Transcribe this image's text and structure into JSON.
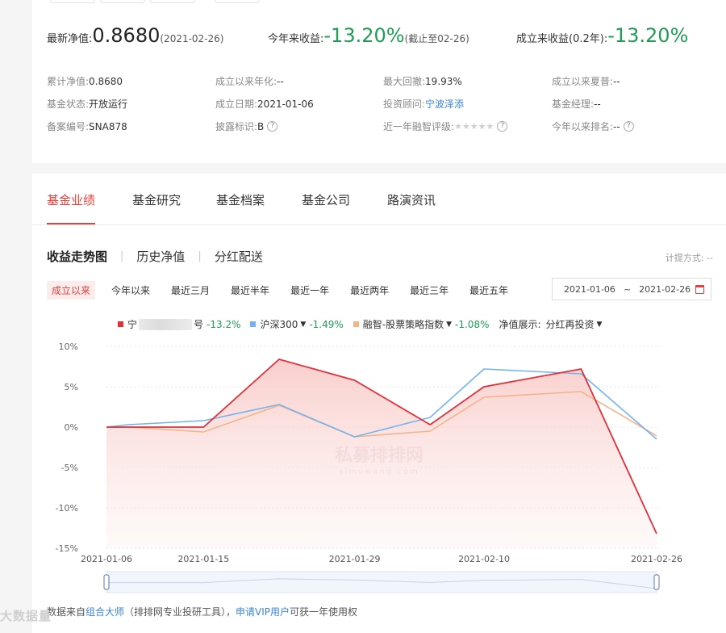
{
  "kpis": {
    "nav_label": "最新净值:",
    "nav_value": "0.8680",
    "nav_date": "(2021-02-26)",
    "ytd_label": "今年来收益:",
    "ytd_value": "-13.20%",
    "ytd_note": "(截止至02-26)",
    "since_label": "成立来收益(0.2年):",
    "since_value": "-13.20%"
  },
  "attributes": [
    {
      "k": "累计净值:",
      "v": "0.8680"
    },
    {
      "k": "成立以来年化:",
      "v": "--"
    },
    {
      "k": "最大回撤:",
      "v": "19.93%"
    },
    {
      "k": "成立以来夏普:",
      "v": "--"
    },
    {
      "k": "基金状态:",
      "v": "开放运行"
    },
    {
      "k": "成立日期:",
      "v": "2021-01-06"
    },
    {
      "k": "投资顾问:",
      "v": "宁波泽添"
    },
    {
      "k": "基金经理:",
      "v": "--"
    },
    {
      "k": "备案编号:",
      "v": "SNA878"
    },
    {
      "k": "披露标识:",
      "v": "B"
    },
    {
      "k": "近一年融智评级:",
      "v": "★★★★★"
    },
    {
      "k": "今年以来排名:",
      "v": "--"
    }
  ],
  "tabs": [
    "基金业绩",
    "基金研究",
    "基金档案",
    "基金公司",
    "路演资讯"
  ],
  "subtabs": [
    "收益走势图",
    "历史净值",
    "分红配送"
  ],
  "calc_label": "计提方式: --",
  "ranges": [
    "成立以来",
    "今年以来",
    "最近三月",
    "最近半年",
    "最近一年",
    "最近两年",
    "最近三年",
    "最近五年"
  ],
  "date_from": "2021-01-06",
  "date_sep": "~",
  "date_to": "2021-02-26",
  "legend": {
    "fund_prefix": "宁",
    "fund_suffix": "号",
    "fund_value": "-13.2%",
    "hs300_name": "沪深300",
    "hs300_value": "-1.49%",
    "idx_name": "融智-股票策略指数",
    "idx_value": "-1.08%",
    "nav_show_label": "净值展示:",
    "nav_show_value": "分红再投资"
  },
  "colors": {
    "fund": "#e0303a",
    "hs300": "#74b3ee",
    "index": "#f3b48a",
    "positive": "#1f9d55",
    "accent": "#e5403b"
  },
  "chart_watermark": "私募排排网",
  "chart_watermark_sub": "simuwang.com",
  "chart_data": {
    "type": "line",
    "x": [
      "2021-01-06",
      "2021-01-08",
      "2021-01-15",
      "2021-01-22",
      "2021-01-29",
      "2021-02-05",
      "2021-02-10",
      "2021-02-19",
      "2021-02-26"
    ],
    "x_ticks": [
      "2021-01-06",
      "2021-01-15",
      "2021-01-29",
      "2021-02-10",
      "2021-02-26"
    ],
    "ylim": [
      -15,
      10
    ],
    "y_ticks": [
      10,
      5,
      0,
      -5,
      -10,
      -15
    ],
    "y_tick_labels": [
      "10%",
      "5%",
      "0%",
      "-5%",
      "-10%",
      "-15%"
    ],
    "grid": true,
    "series": [
      {
        "name": "宁…号",
        "values": [
          0,
          0,
          0,
          8.4,
          5.8,
          0.3,
          5.0,
          7.2,
          -13.2
        ]
      },
      {
        "name": "沪深300",
        "values": [
          0,
          0.3,
          0.8,
          2.8,
          -1.2,
          1.2,
          7.2,
          6.6,
          -1.49
        ]
      },
      {
        "name": "融智-股票策略指数",
        "values": [
          0,
          0,
          -0.6,
          2.7,
          -1.2,
          -0.5,
          3.7,
          4.4,
          -1.08
        ]
      }
    ]
  },
  "footer": {
    "p1": "数据来自",
    "link1": "组合大师",
    "p2": "（排排网专业投研工具），",
    "link2": "申请VIP用户",
    "p3": "可获一年使用权"
  },
  "corner_watermark": "大数据量"
}
